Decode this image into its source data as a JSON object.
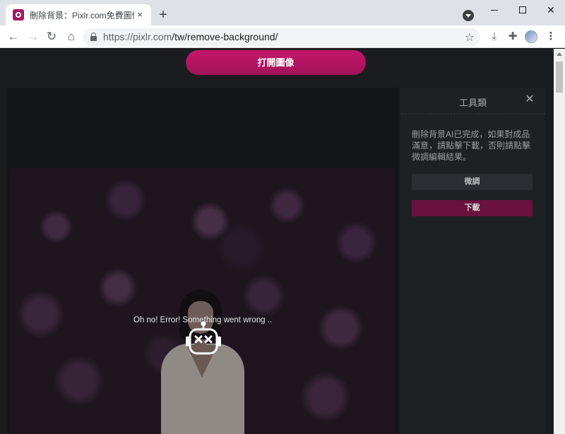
{
  "browser": {
    "tab": {
      "title": "刪除背景：Pixlr.com免費圖像刪",
      "close_glyph": "×",
      "favicon": "pixlr-favicon"
    },
    "new_tab_glyph": "+",
    "window_controls": {
      "close_glyph": "✕"
    },
    "toolbar": {
      "back_glyph": "←",
      "forward_glyph": "→",
      "reload_glyph": "↻",
      "home_glyph": "⌂",
      "url_host": "https://pixlr.com",
      "url_path": "/tw/remove-background/",
      "star_glyph": "☆",
      "download_glyph": "⤓",
      "extensions_glyph": "✚",
      "menu_glyph": "⋮"
    }
  },
  "page": {
    "open_image_label": "打開圖像",
    "error_message": "Oh no! Error! Something went wrong ..",
    "panel": {
      "title": "工具類",
      "close_glyph": "✕",
      "description": "刪除背景AI已完成，如果對成品滿意，請點擊下載，否則請點擊微調編輯結果。",
      "finetune_label": "微調",
      "download_label": "下載"
    }
  },
  "colors": {
    "accent": "#c4176a",
    "download_button": "#68123d",
    "page_background": "#1b1c1f",
    "panel_background": "#1f2024"
  }
}
